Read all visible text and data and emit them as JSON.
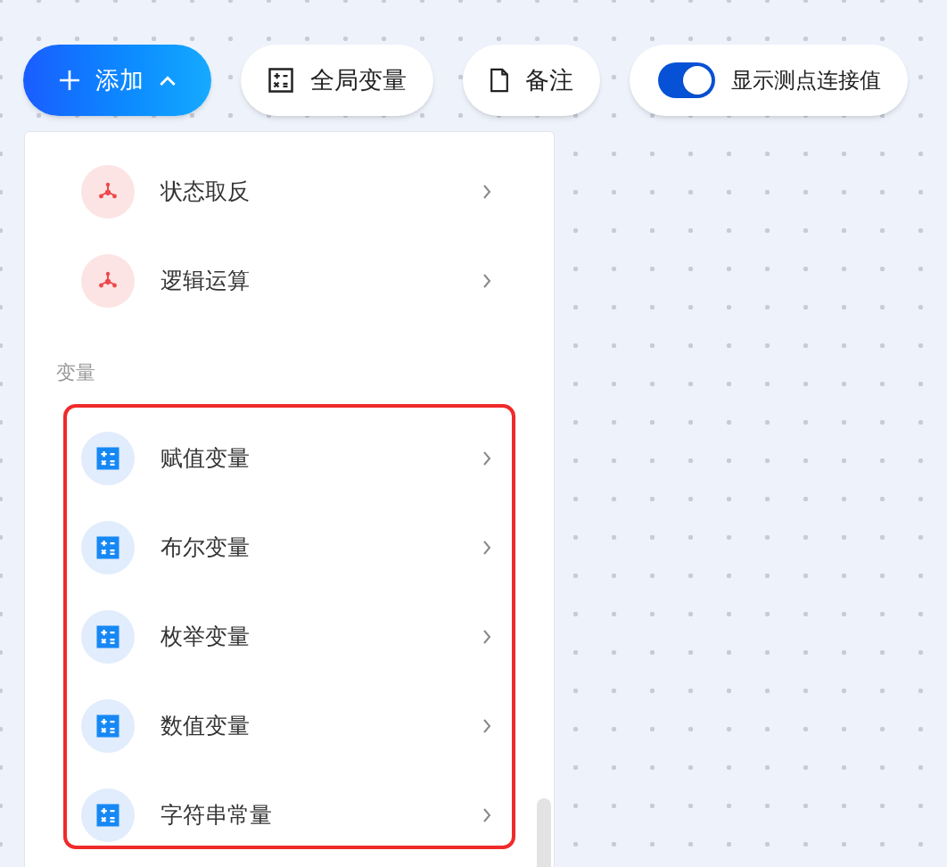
{
  "toolbar": {
    "add_button": {
      "label": "添加",
      "expanded": true
    },
    "buttons": [
      {
        "kind": "variables",
        "label": "全局变量"
      },
      {
        "kind": "note",
        "label": "备注"
      }
    ],
    "toggle": {
      "label": "显示测点连接值",
      "on": true
    }
  },
  "menu": {
    "sections": [
      {
        "items": [
          {
            "kind": "logic",
            "label": "状态取反"
          },
          {
            "kind": "logic",
            "label": "逻辑运算"
          }
        ]
      },
      {
        "heading": "变量",
        "highlighted": true,
        "items": [
          {
            "kind": "variable",
            "label": "赋值变量"
          },
          {
            "kind": "variable",
            "label": "布尔变量"
          },
          {
            "kind": "variable",
            "label": "枚举变量"
          },
          {
            "kind": "variable",
            "label": "数值变量"
          },
          {
            "kind": "variable",
            "label": "字符串常量"
          }
        ]
      }
    ]
  }
}
